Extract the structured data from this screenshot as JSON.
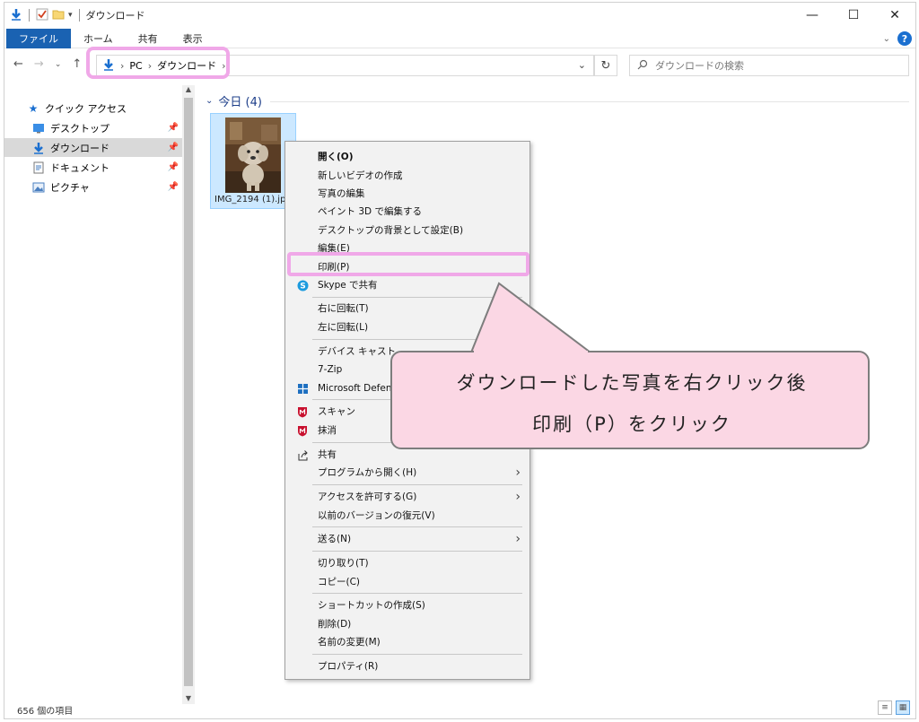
{
  "title": {
    "window_title": "ダウンロード",
    "minimize": "—",
    "maximize": "☐",
    "close": "✕"
  },
  "ribbon": {
    "tabs": [
      "ファイル",
      "ホーム",
      "共有",
      "表示"
    ]
  },
  "address": {
    "crumbs": [
      "PC",
      "ダウンロード"
    ],
    "search_placeholder": "ダウンロードの検索"
  },
  "nav": {
    "quick_access": "クイック アクセス",
    "items": [
      "デスクトップ",
      "ダウンロード",
      "ドキュメント",
      "ピクチャ"
    ]
  },
  "content": {
    "group_label": "今日 (4)",
    "file_name": "IMG_2194 (1).jpg"
  },
  "menu": {
    "items": [
      "開く(O)",
      "新しいビデオの作成",
      "写真の編集",
      "ペイント 3D で編集する",
      "デスクトップの背景として設定(B)",
      "編集(E)",
      "印刷(P)",
      "Skype で共有",
      "右に回転(T)",
      "左に回転(L)",
      "デバイス キャスト",
      "7-Zip",
      "Microsoft Defender",
      "スキャン",
      "抹消",
      "共有",
      "プログラムから開く(H)",
      "アクセスを許可する(G)",
      "以前のバージョンの復元(V)",
      "送る(N)",
      "切り取り(T)",
      "コピー(C)",
      "ショートカットの作成(S)",
      "削除(D)",
      "名前の変更(M)",
      "プロパティ(R)"
    ]
  },
  "callout": {
    "line1": "ダウンロードした写真を右クリック後",
    "line2": "印刷（P）をクリック"
  },
  "status": {
    "count": "656 個の項目"
  },
  "colors": {
    "highlight": "#f0a8e8",
    "callout_bg": "#fbd7e4",
    "accent": "#1a62b2"
  }
}
